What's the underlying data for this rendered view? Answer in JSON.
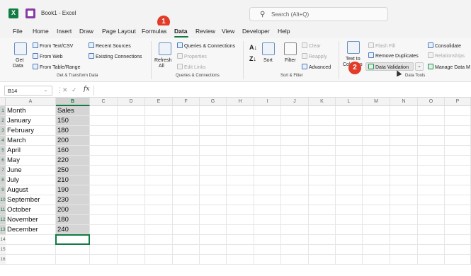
{
  "window": {
    "doc_title": "Book1 - Excel",
    "search_placeholder": "Search (Alt+Q)"
  },
  "menu": {
    "items": [
      "File",
      "Home",
      "Insert",
      "Draw",
      "Page Layout",
      "Formulas",
      "Data",
      "Review",
      "View",
      "Developer",
      "Help"
    ],
    "active": "Data"
  },
  "callouts": [
    "1",
    "2"
  ],
  "ribbon": {
    "get_transform": {
      "get_data": "Get",
      "get_data_sub": "Data",
      "from_text_csv": "From Text/CSV",
      "from_web": "From Web",
      "from_table_range": "From Table/Range",
      "recent_sources": "Recent Sources",
      "existing_connections": "Existing Connections",
      "label": "Get & Transform Data"
    },
    "queries": {
      "refresh": "Refresh",
      "refresh_sub": "All",
      "queries_connections": "Queries & Connections",
      "properties": "Properties",
      "edit_links": "Edit Links",
      "label": "Queries & Connections"
    },
    "sort_filter": {
      "sort": "Sort",
      "filter": "Filter",
      "clear": "Clear",
      "reapply": "Reapply",
      "advanced": "Advanced",
      "label": "Sort & Filter"
    },
    "data_tools": {
      "text_to": "Text to",
      "columns": "Columns",
      "flash_fill": "Flash Fill",
      "remove_duplicates": "Remove Duplicates",
      "data_validation": "Data Validation",
      "consolidate": "Consolidate",
      "relationships": "Relationships",
      "manage_data": "Manage Data M",
      "label": "Data Tools"
    }
  },
  "formula_bar": {
    "name_box": "B14",
    "fx": "fx",
    "content": ""
  },
  "sheet": {
    "columns": [
      "A",
      "B",
      "C",
      "D",
      "E",
      "F",
      "G",
      "H",
      "I",
      "J",
      "K",
      "L",
      "M",
      "N",
      "O",
      "P"
    ],
    "row_numbers": [
      "1",
      "2",
      "3",
      "4",
      "5",
      "6",
      "7",
      "8",
      "9",
      "10",
      "11",
      "12",
      "13",
      "14",
      "15",
      "16"
    ],
    "rows": [
      [
        "Month",
        "Sales"
      ],
      [
        "January",
        "150"
      ],
      [
        "February",
        "180"
      ],
      [
        "March",
        "200"
      ],
      [
        "April",
        "160"
      ],
      [
        "May",
        "220"
      ],
      [
        "June",
        "250"
      ],
      [
        "July",
        "210"
      ],
      [
        "August",
        "190"
      ],
      [
        "September",
        "230"
      ],
      [
        "October",
        "200"
      ],
      [
        "November",
        "180"
      ],
      [
        "December",
        "240"
      ]
    ],
    "selected_column": "B",
    "active_cell": "B14"
  },
  "colors": {
    "excel_green": "#107c41",
    "callout_red": "#e23b28",
    "selection_gray": "#d5d5d5"
  }
}
